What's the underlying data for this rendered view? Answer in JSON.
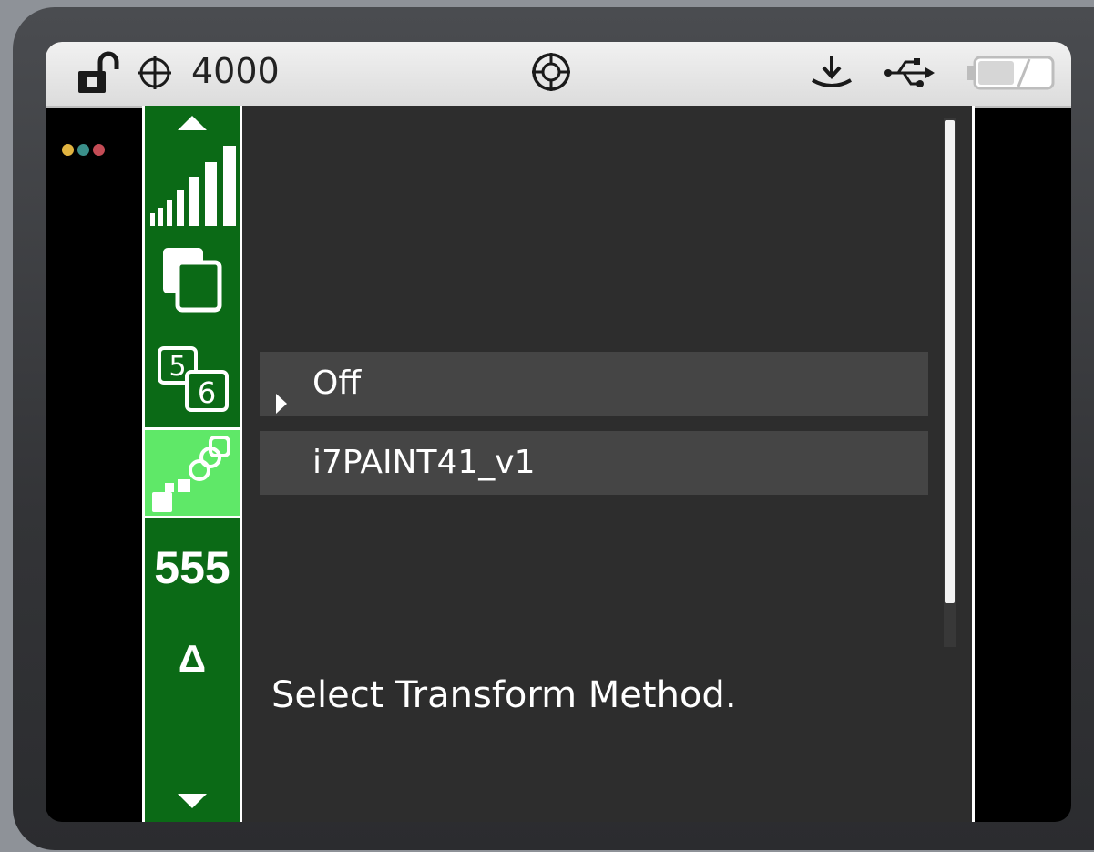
{
  "status_bar": {
    "lock_icon": "unlock-icon",
    "target_icon": "crosshair-icon",
    "target_value": "4000",
    "center_icon": "circle-crosshair-icon",
    "right_icons": [
      "download-icon",
      "usb-icon",
      "battery-icon"
    ],
    "battery_level": 0.5
  },
  "window_dots": {
    "colors": [
      "#e0b340",
      "#3a8f8a",
      "#c44c56"
    ]
  },
  "sidebar": {
    "scroll_up_icon": "triangle-up-icon",
    "items": [
      {
        "icon": "signal-bars-icon"
      },
      {
        "icon": "copy-layers-icon"
      },
      {
        "icon": "5-6-icon",
        "small": "5",
        "big": "6"
      },
      {
        "icon": "transform-points-icon",
        "selected": true
      }
    ],
    "number": "555",
    "delta": "Δ",
    "scroll_down_icon": "triangle-down-icon"
  },
  "menu": {
    "options": [
      {
        "label": "Off",
        "selected": true
      },
      {
        "label": "i7PAINT41_v1",
        "selected": false
      }
    ],
    "message": "Select Transform Method."
  },
  "colors": {
    "accent_green": "#0b6a16",
    "selected_green": "#5fe868",
    "panel_bg": "#2d2d2d",
    "option_bg": "#454545"
  }
}
